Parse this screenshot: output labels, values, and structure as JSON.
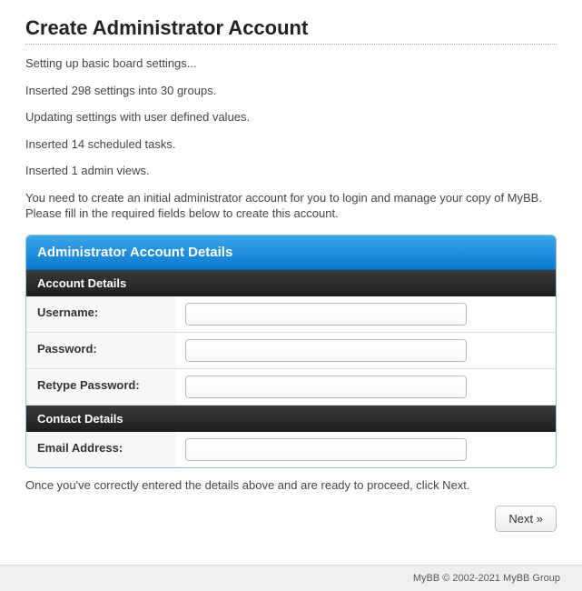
{
  "page": {
    "title": "Create Administrator Account"
  },
  "msgs": {
    "m1": "Setting up basic board settings...",
    "m2": "Inserted 298 settings into 30 groups.",
    "m3": "Updating settings with user defined values.",
    "m4": "Inserted 14 scheduled tasks.",
    "m5": "Inserted 1 admin views.",
    "m6": "You need to create an initial administrator account for you to login and manage your copy of MyBB. Please fill in the required fields below to create this account."
  },
  "form": {
    "title": "Administrator Account Details",
    "section_account": "Account Details",
    "section_contact": "Contact Details",
    "username_label": "Username:",
    "username_value": "",
    "password_label": "Password:",
    "password_value": "",
    "retype_label": "Retype Password:",
    "retype_value": "",
    "email_label": "Email Address:",
    "email_value": ""
  },
  "post": {
    "instruction": "Once you've correctly entered the details above and are ready to proceed, click Next.",
    "next_label": "Next »"
  },
  "footer": {
    "text": "MyBB © 2002-2021 MyBB Group"
  }
}
